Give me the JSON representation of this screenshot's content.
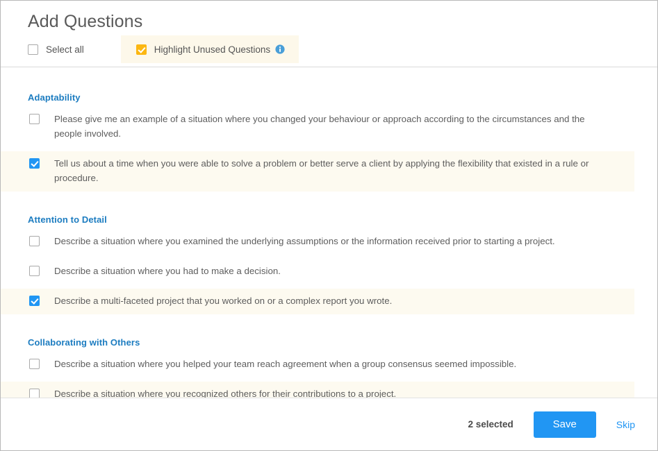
{
  "header": {
    "title": "Add Questions",
    "select_all_label": "Select all",
    "select_all_checked": false,
    "highlight_unused_label": "Highlight Unused Questions",
    "highlight_unused_checked": true,
    "info_icon": "info-circle-icon"
  },
  "colors": {
    "accent_blue": "#2196f3",
    "section_heading_blue": "#1c7cc0",
    "amber_checkbox": "#fcb712",
    "highlight_band": "#fdfaf0",
    "header_highlight_band": "#fdf8ea"
  },
  "sections": [
    {
      "title": "Adaptability",
      "questions": [
        {
          "text": "Please give me an example of a situation where you changed your behaviour or approach according to the circumstances and the people involved.",
          "checked": false,
          "unused": false
        },
        {
          "text": "Tell us about a time when you were able to solve a problem or better serve a client by applying the flexibility that existed in a rule or procedure.",
          "checked": true,
          "unused": true
        }
      ]
    },
    {
      "title": "Attention to Detail",
      "questions": [
        {
          "text": "Describe a situation where you examined the underlying assumptions or the information received prior to starting a project.",
          "checked": false,
          "unused": false
        },
        {
          "text": "Describe a situation where you had to make a decision.",
          "checked": false,
          "unused": false
        },
        {
          "text": "Describe a multi-faceted project that you worked on or a complex report you wrote.",
          "checked": true,
          "unused": true
        }
      ]
    },
    {
      "title": "Collaborating with Others",
      "questions": [
        {
          "text": "Describe a situation where you helped your team reach agreement when a group consensus seemed impossible.",
          "checked": false,
          "unused": false
        },
        {
          "text": "Describe a situation where you recognized others for their contributions to a project.",
          "checked": false,
          "unused": true
        }
      ]
    }
  ],
  "footer": {
    "selected_count_label": "2 selected",
    "save_label": "Save",
    "skip_label": "Skip"
  }
}
